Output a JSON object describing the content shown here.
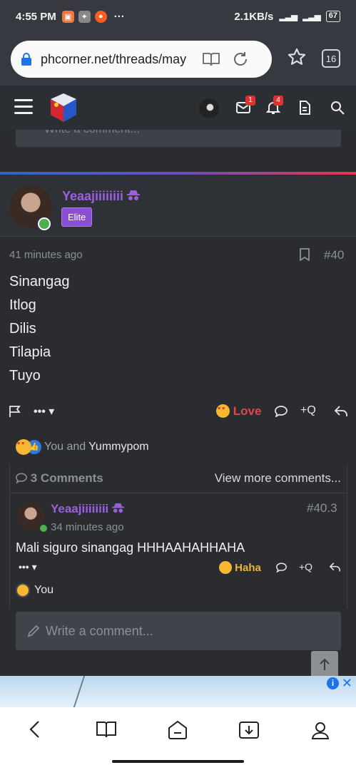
{
  "status_bar": {
    "time": "4:55 PM",
    "net_speed": "2.1KB/s",
    "battery": "67",
    "more": "···"
  },
  "browser": {
    "url": "phcorner.net/threads/may",
    "tab_count": "16"
  },
  "header": {
    "messages_badge": "1",
    "alerts_badge": "4"
  },
  "partial_comment": {
    "placeholder": "Write a comment..."
  },
  "post": {
    "username": "Yeaajiiiiiiii",
    "rank": "Elite",
    "time": "41 minutes ago",
    "number": "#40",
    "lines": [
      "Sinangag",
      "Itlog",
      "Dilis",
      "Tilapia",
      "Tuyo"
    ],
    "reaction_label": "Love",
    "quote_label": "+Q",
    "more_label": "•••",
    "reactions": {
      "prefix": "You and",
      "names": "Yummypom"
    }
  },
  "comments": {
    "count_label": "3 Comments",
    "view_more": "View more comments...",
    "items": [
      {
        "username": "Yeaajiiiiiiii",
        "time": "34 minutes ago",
        "number": "#40.3",
        "body": "Mali siguro sinangag HHHAAHAHHAHA",
        "reaction_label": "Haha",
        "quote_label": "+Q",
        "more_label": "•••",
        "reactors": "You"
      }
    ],
    "write_placeholder": "Write a comment..."
  },
  "colors": {
    "accent_purple": "#9b5fe0",
    "love_red": "#e34550",
    "haha_yellow": "#f2b233",
    "bg": "#2a2c30"
  }
}
